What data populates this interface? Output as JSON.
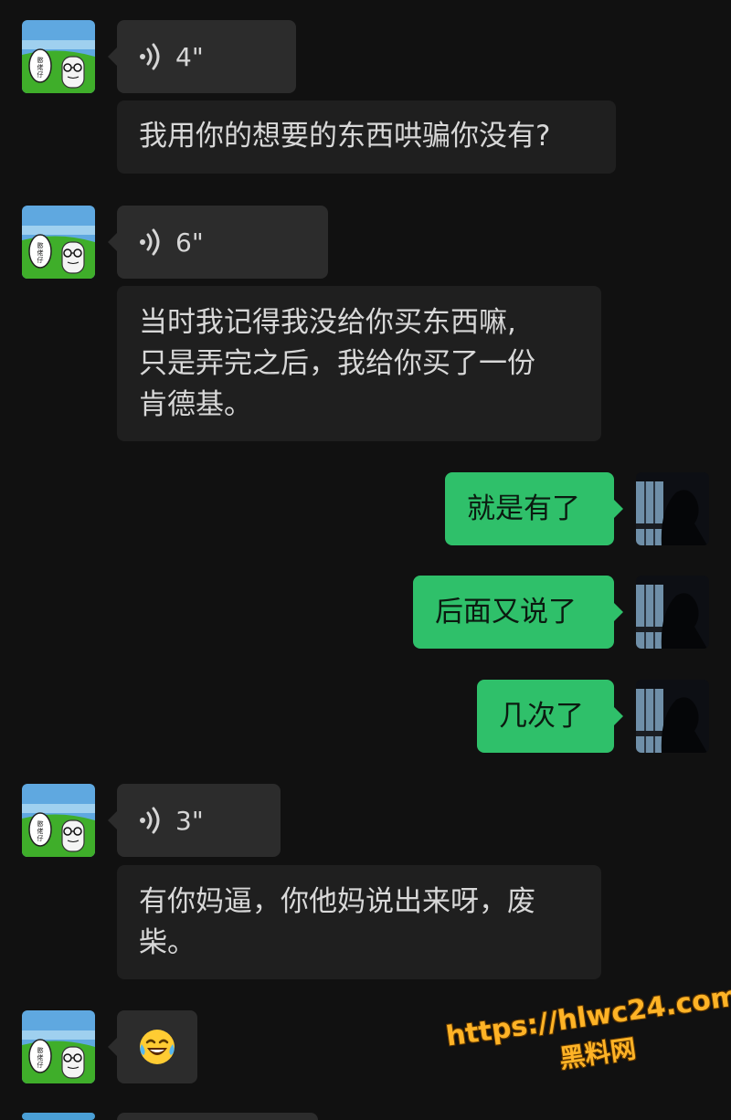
{
  "messages": [
    {
      "kind": "voice",
      "side": "in",
      "duration": "4\""
    },
    {
      "kind": "text",
      "side": "in",
      "lines": [
        "我用你的想要的东西哄骗你没有?"
      ]
    },
    {
      "kind": "voice",
      "side": "in",
      "duration": "6\""
    },
    {
      "kind": "text",
      "side": "in",
      "lines": [
        "当时我记得我没给你买东西嘛,",
        "只是弄完之后，我给你买了一份",
        "肯德基。"
      ]
    },
    {
      "kind": "text",
      "side": "out",
      "text": "就是有了"
    },
    {
      "kind": "text",
      "side": "out",
      "text": "后面又说了"
    },
    {
      "kind": "text",
      "side": "out",
      "text": "几次了"
    },
    {
      "kind": "voice",
      "side": "in",
      "duration": "3\""
    },
    {
      "kind": "text",
      "side": "in",
      "lines": [
        "有你妈逼，你他妈说出来呀，废",
        "柴。"
      ]
    },
    {
      "kind": "emoji",
      "side": "in",
      "emoji": "😂"
    }
  ],
  "avatar_left": {
    "badge_text": "憨佬仔",
    "colors": {
      "sky": "#5fa8e0",
      "grass": "#3fae2a"
    }
  },
  "avatar_right": {
    "colors": {
      "bg": "#0d0f14",
      "window": "#6f8fa8"
    }
  },
  "watermark": {
    "url": "https://hlwc24.com",
    "site": "黑料网",
    "color": "#ffb326"
  },
  "colors": {
    "background": "#111111",
    "bubble_in": "#2c2c2c",
    "bubble_text": "#1f1f1f",
    "bubble_out": "#2fc06a"
  }
}
